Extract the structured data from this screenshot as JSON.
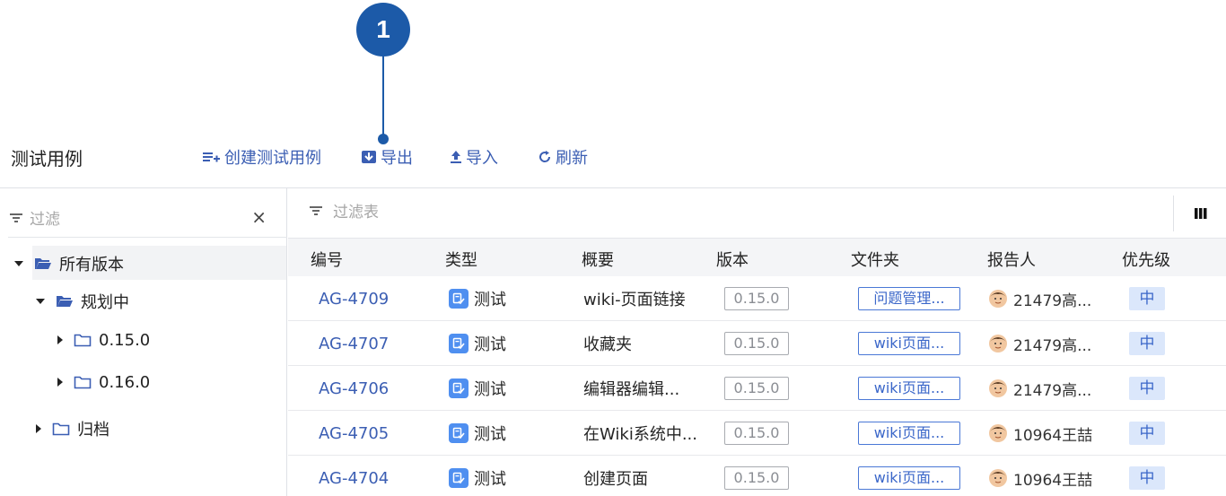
{
  "callout": {
    "number": "1"
  },
  "page_title": "测试用例",
  "toolbar": {
    "create_label": "创建测试用例",
    "export_label": "导出",
    "import_label": "导入",
    "refresh_label": "刷新"
  },
  "left_filter": {
    "placeholder": "过滤",
    "close_glyph": "×"
  },
  "tree": {
    "all_versions": "所有版本",
    "planning": "规划中",
    "v0150": "0.15.0",
    "v0160": "0.16.0",
    "archive": "归档"
  },
  "right_filter": {
    "placeholder": "过滤表"
  },
  "table": {
    "headers": {
      "key": "编号",
      "type": "类型",
      "summary": "概要",
      "version": "版本",
      "folder": "文件夹",
      "reporter": "报告人",
      "priority": "优先级"
    },
    "rows": [
      {
        "key": "AG-4709",
        "type": "测试",
        "summary": "wiki-页面链接",
        "version": "0.15.0",
        "folder": "问题管理...",
        "reporter": "21479高...",
        "priority": "中"
      },
      {
        "key": "AG-4707",
        "type": "测试",
        "summary": "收藏夹",
        "version": "0.15.0",
        "folder": "wiki页面...",
        "reporter": "21479高...",
        "priority": "中"
      },
      {
        "key": "AG-4706",
        "type": "测试",
        "summary": "编辑器编辑...",
        "version": "0.15.0",
        "folder": "wiki页面...",
        "reporter": "21479高...",
        "priority": "中"
      },
      {
        "key": "AG-4705",
        "type": "测试",
        "summary": "在Wiki系统中...",
        "version": "0.15.0",
        "folder": "wiki页面...",
        "reporter": "10964王喆",
        "priority": "中"
      },
      {
        "key": "AG-4704",
        "type": "测试",
        "summary": "创建页面",
        "version": "0.15.0",
        "folder": "wiki页面...",
        "reporter": "10964王喆",
        "priority": "中"
      }
    ]
  },
  "colors": {
    "accent": "#3b5eb3",
    "callout": "#1c5aa8",
    "type_icon": "#4f8ff0",
    "priority_bg": "#dbe7fb"
  }
}
